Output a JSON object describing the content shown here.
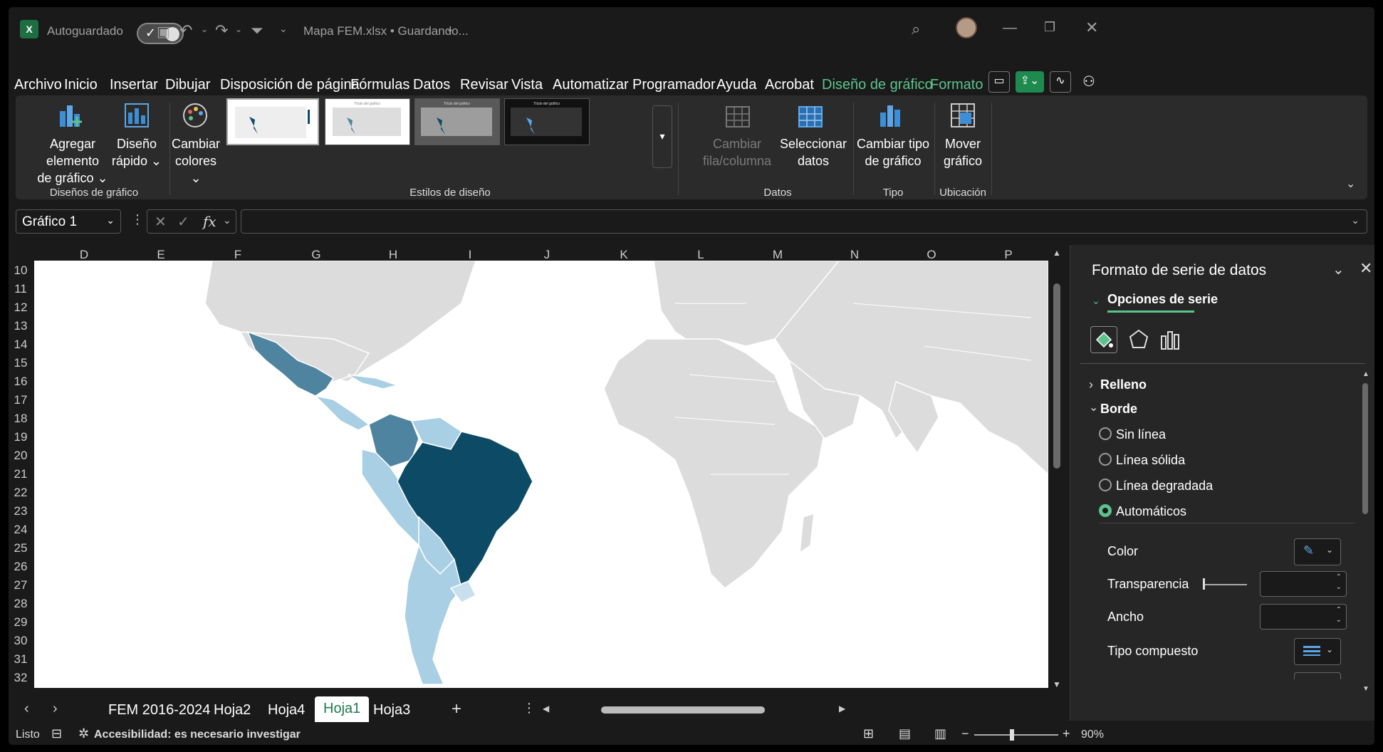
{
  "titlebar": {
    "autosave_label": "Autoguardado",
    "file_title": "Mapa FEM.xlsx • Guardando..."
  },
  "menu": {
    "tabs": [
      "Archivo",
      "Inicio",
      "Insertar",
      "Dibujar",
      "Disposición de página",
      "Fórmulas",
      "Datos",
      "Revisar",
      "Vista",
      "Automatizar",
      "Programador",
      "Ayuda",
      "Acrobat",
      "Diseño de gráfico",
      "Formato"
    ],
    "active_tab": "Diseño de gráfico"
  },
  "ribbon": {
    "add_element": "Agregar elemento",
    "add_element_2": "de gráfico",
    "quick_layout": "Diseño",
    "quick_layout_2": "rápido",
    "change_colors": "Cambiar",
    "change_colors_2": "colores",
    "switch_rowcol": "Cambiar",
    "switch_rowcol_2": "fila/columna",
    "select_data": "Seleccionar",
    "select_data_2": "datos",
    "change_type": "Cambiar tipo",
    "change_type_2": "de gráfico",
    "move_chart": "Mover",
    "move_chart_2": "gráfico",
    "group_layouts": "Diseños de gráfico",
    "group_styles": "Estilos de diseño",
    "group_data": "Datos",
    "group_type": "Tipo",
    "group_location": "Ubicación"
  },
  "formula_bar": {
    "name_box": "Gráfico 1",
    "fx": "fx"
  },
  "grid": {
    "columns": [
      "D",
      "E",
      "F",
      "G",
      "H",
      "I",
      "J",
      "K",
      "L",
      "M",
      "N",
      "O",
      "P"
    ],
    "rows": [
      "10",
      "11",
      "12",
      "13",
      "14",
      "15",
      "16",
      "17",
      "18",
      "19",
      "20",
      "21",
      "22",
      "23",
      "24",
      "25",
      "26",
      "27",
      "28",
      "29",
      "30",
      "31",
      "32"
    ]
  },
  "sheets": {
    "tabs": [
      "FEM 2016-2024",
      "Hoja2",
      "Hoja4",
      "Hoja1",
      "Hoja3"
    ],
    "active": "Hoja1"
  },
  "status": {
    "ready": "Listo",
    "accessibility": "Accesibilidad: es necesario investigar",
    "zoom": "90%"
  },
  "pane": {
    "title": "Formato de serie de datos",
    "section": "Opciones de serie",
    "fill": "Relleno",
    "border": "Borde",
    "options": [
      "Sin línea",
      "Línea sólida",
      "Línea degradada",
      "Automáticos"
    ],
    "selected_option": "Automáticos",
    "color": "Color",
    "transparency": "Transparencia",
    "width": "Ancho",
    "compound": "Tipo compuesto"
  },
  "colors": {
    "accent": "#5cc48b",
    "map_dark": "#0d4a66",
    "map_mid": "#4f84a0",
    "map_light": "#a8cfe3",
    "map_gray": "#dcdcdc"
  }
}
